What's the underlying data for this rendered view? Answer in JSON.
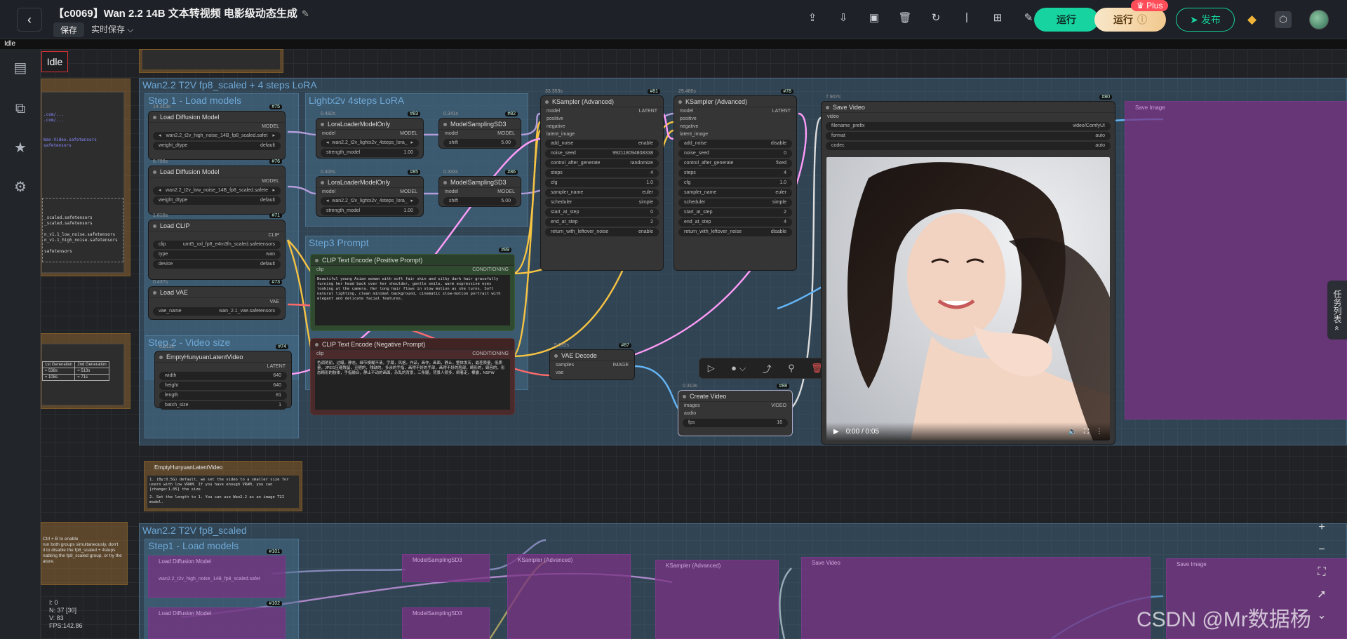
{
  "header": {
    "title": "【c0069】Wan 2.2 14B 文本转视频 电影级动态生成",
    "save_label": "保存",
    "autosave_label": "实时保存",
    "run_label": "运行",
    "run2_label": "运行",
    "plus_label": "Plus",
    "publish_label": "发布"
  },
  "status": {
    "idle_strip": "Idle",
    "idle_box": "Idle"
  },
  "groups": {
    "top_main": "Wan2.2 T2V fp8_scaled + 4 steps LoRA",
    "step1": "Step 1 - Load models",
    "lightx": "Lightx2v 4steps LoRA",
    "step3": "Step3 Prompt",
    "step2": "Step 2 - Video size",
    "bottom_main": "Wan2.2 T2V fp8_scaled",
    "bottom_step1": "Step1 - Load models"
  },
  "nodes": {
    "load_diff1": {
      "title": "Load Diffusion Model",
      "timing": "14.313s",
      "badge": "#75",
      "out": "MODEL",
      "unet": "wan2.2_t2v_high_noise_14B_fp8_scaled.safet",
      "dtype_label": "weight_dtype",
      "dtype": "default"
    },
    "load_diff2": {
      "title": "Load Diffusion Model",
      "timing": "6.796s",
      "badge": "#76",
      "out": "MODEL",
      "unet": "wan2.2_t2v_low_noise_14B_fp8_scaled.safete",
      "dtype_label": "weight_dtype",
      "dtype": "default"
    },
    "load_clip": {
      "title": "Load CLIP",
      "timing": "1.616s",
      "badge": "#71",
      "out": "CLIP",
      "clip_label": "clip",
      "clip": "umt5_xxl_fp8_e4m3fn_scaled.safetensors",
      "type_label": "type",
      "type": "wan",
      "device_label": "device",
      "device": "default"
    },
    "load_vae": {
      "title": "Load VAE",
      "timing": "0.437s",
      "badge": "#73",
      "out": "VAE",
      "vae_label": "vae_name",
      "vae": "wan_2.1_vae.safetensors"
    },
    "lora1": {
      "title": "LoraLoaderModelOnly",
      "timing": "0.482s",
      "badge": "#83",
      "in": "model",
      "out": "MODEL",
      "lora": "wan2.2_t2v_lightx2v_4steps_lora_",
      "strength_label": "strength_model",
      "strength": "1.00"
    },
    "lora2": {
      "title": "LoraLoaderModelOnly",
      "timing": "0.406s",
      "badge": "#85",
      "in": "model",
      "out": "MODEL",
      "lora": "wan2.2_t2v_lightx2v_4steps_lora_",
      "strength_label": "strength_model",
      "strength": "1.00"
    },
    "msd1": {
      "title": "ModelSamplingSD3",
      "timing": "0.341s",
      "badge": "#82",
      "in": "model",
      "out": "MODEL",
      "shift_label": "shift",
      "shift": "5.00"
    },
    "msd2": {
      "title": "ModelSamplingSD3",
      "timing": "0.333s",
      "badge": "#86",
      "in": "model",
      "out": "MODEL",
      "shift_label": "shift",
      "shift": "5.00"
    },
    "pos": {
      "title": "CLIP Text Encode (Positive Prompt)",
      "badge": "#89",
      "in": "clip",
      "out": "CONDITIONING",
      "text": "Beautiful young Asian woman with soft fair skin and silky dark hair gracefully turning her head back over her shoulder, gentle smile, warm expressive eyes looking at the camera. Her long hair flows in slow motion as she turns. Soft natural lighting, clean minimal background, cinematic slow-motion portrait with elegant and delicate facial features."
    },
    "neg": {
      "title": "CLIP Text Encode (Negative Prompt)",
      "in": "clip",
      "out": "CONDITIONING",
      "text": "色调艳丽，过曝，静态，细节模糊不清，字幕，风格，作品，画作，画面，静止，整体发灰，最差质量，低质量，JPEG压缩残留，丑陋的，残缺的，多余的手指，画得不好的手部，画得不好的脸部，畸形的，毁容的，形态畸形的肢体，手指融合，静止不动的画面，杂乱的背景，三条腿，背景人很多，倒着走，裸露，NSFW"
    },
    "ks1": {
      "title": "KSampler (Advanced)",
      "timing": "33.353s",
      "badge": "#81",
      "out": "LATENT",
      "inputs": [
        "model",
        "positive",
        "negative",
        "latent_image"
      ],
      "widgets": [
        [
          "add_noise",
          "enable"
        ],
        [
          "noise_seed",
          "992118094808338"
        ],
        [
          "control_after_generate",
          "randomize"
        ],
        [
          "steps",
          "4"
        ],
        [
          "cfg",
          "1.0"
        ],
        [
          "sampler_name",
          "euler"
        ],
        [
          "scheduler",
          "simple"
        ],
        [
          "start_at_step",
          "0"
        ],
        [
          "end_at_step",
          "2"
        ],
        [
          "return_with_leftover_noise",
          "enable"
        ]
      ]
    },
    "ks2": {
      "title": "KSampler (Advanced)",
      "timing": "29.480s",
      "badge": "#78",
      "out": "LATENT",
      "inputs": [
        "model",
        "positive",
        "negative",
        "latent_image"
      ],
      "widgets": [
        [
          "add_noise",
          "disable"
        ],
        [
          "noise_seed",
          "0"
        ],
        [
          "control_after_generate",
          "fixed"
        ],
        [
          "steps",
          "4"
        ],
        [
          "cfg",
          "1.0"
        ],
        [
          "sampler_name",
          "euler"
        ],
        [
          "scheduler",
          "simple"
        ],
        [
          "start_at_step",
          "2"
        ],
        [
          "end_at_step",
          "4"
        ],
        [
          "return_with_leftover_noise",
          "disable"
        ]
      ]
    },
    "latent": {
      "title": "EmptyHunyuanLatentVideo",
      "timing": "0.313s",
      "badge": "#74",
      "out": "LATENT",
      "widgets": [
        [
          "width",
          "640"
        ],
        [
          "height",
          "640"
        ],
        [
          "length",
          "81"
        ],
        [
          "batch_size",
          "1"
        ]
      ]
    },
    "vae_decode": {
      "title": "VAE Decode",
      "timing": "5.032s",
      "badge": "#87",
      "in1": "samples",
      "in2": "vae",
      "out": "IMAGE"
    },
    "create_video": {
      "title": "Create Video",
      "timing": "0.313s",
      "badge": "#88",
      "in1": "images",
      "in2": "audio",
      "out": "VIDEO",
      "fps_label": "fps",
      "fps": "16"
    },
    "save_video": {
      "title": "Save Video",
      "timing": "7.907s",
      "badge": "#80",
      "in": "video",
      "widgets": [
        [
          "filename_prefix",
          "video/ComfyUI"
        ],
        [
          "format",
          "auto"
        ],
        [
          "codec",
          "auto"
        ]
      ]
    },
    "save_image_ghost": {
      "title": "Save Image"
    },
    "note_latent": {
      "title": "EmptyHunyuanLatentVideo",
      "line1": "1. (By:0.5G) default, we set the video to a smaller size for users with low VRAM. If you have enough VRAM, you can [change:1.05] the size",
      "line2": "2. Set the length to 1. You can use Wan2.2 as an image T2I model."
    }
  },
  "video": {
    "time": "0:00 / 0:05"
  },
  "left_notes": {
    "table_h1": "1st Generation",
    "table_h2": "2nd Generation",
    "r1c1": "≈ 538s",
    "r1c2": "≈ 513s",
    "r2c1": "≈ 108s",
    "r2c2": "≈ 71s",
    "bottom_note": "Ctrl + B to enable\nrun both groups simultaneously, don't\nit to disable the fp8_scaled + 4steps\nnabling the fp8_scaled group, or try the\nature.",
    "model_list": "_scaled.safetensors\n_scaled.safetensors\n\nn_v1.1_low_noise.safetensors\nn_v1.1_high_noise.safetensors\n\nsafetensors"
  },
  "bottom_nodes": {
    "load_diff": "Load Diffusion Model",
    "unet": "wan2.2_t2v_high_noise_14B_fp8_scaled.safet",
    "msd": "ModelSamplingSD3",
    "ks1": "KSampler (Advanced)",
    "ks2": "KSampler (Advanced)",
    "save_video": "Save Video",
    "save_image": "Save Image",
    "badge1": "#101",
    "badge2": "#102"
  },
  "stats": {
    "i": "I: 0",
    "n": "N: 37 [30]",
    "v": "V: 83",
    "fps": "FPS:142.86"
  },
  "right_tab": "任务列表",
  "watermark": "CSDN @Mr数据杨",
  "colors": {
    "accent": "#16d3a0",
    "wire_model": "#b39ddb",
    "wire_clip": "#f6c343",
    "wire_latent": "#ff9cf9",
    "wire_image": "#64b5f6",
    "group": "#466e8c"
  }
}
